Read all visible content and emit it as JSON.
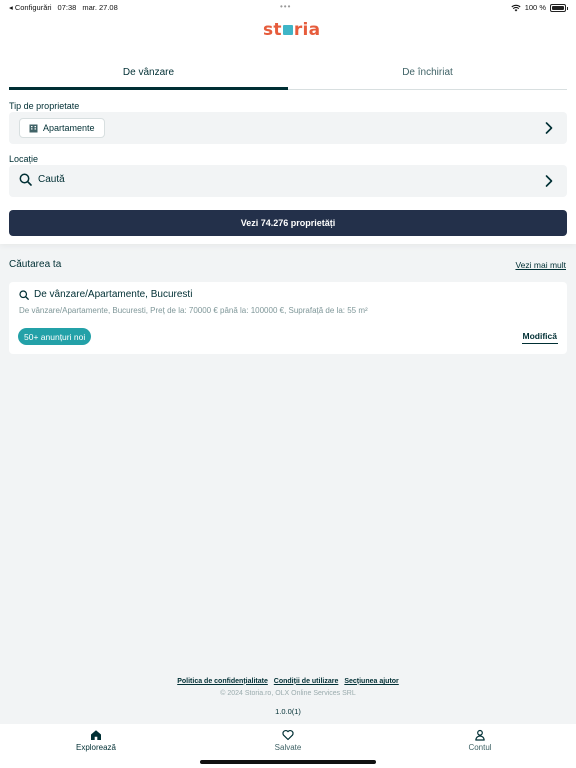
{
  "status_bar": {
    "back_app": "◂ Configurări",
    "time": "07:38",
    "date": "mar. 27.08",
    "dots": "•••",
    "battery": "100 %"
  },
  "brand": {
    "logo_part1": "st",
    "logo_part2": "ria",
    "accent_color": "#e65c3c",
    "square_color": "#3fb5c7"
  },
  "tabs": [
    {
      "label": "De vânzare",
      "active": true
    },
    {
      "label": "De închiriat",
      "active": false
    }
  ],
  "filters": {
    "property_type_label": "Tip de proprietate",
    "property_type_value": "Apartamente",
    "location_label": "Locație",
    "location_placeholder": "Caută"
  },
  "cta": {
    "label": "Vezi 74.276 proprietăți"
  },
  "saved_search": {
    "section_title": "Căutarea ta",
    "see_more": "Vezi mai mult",
    "title": "De vânzare/Apartamente, Bucuresti",
    "description": "De vânzare/Apartamente, Bucuresti, Preț de la: 70000 € până la: 100000 €, Suprafață de la: 55 m²",
    "badge": "50+ anunțuri noi",
    "edit_label": "Modifică"
  },
  "footer": {
    "links": [
      "Politica de confidențialitate",
      "Condiții de utilizare",
      "Secțiunea ajutor"
    ],
    "copyright": "© 2024 Storia.ro, OLX Online Services SRL",
    "version": "1.0.0(1)"
  },
  "bottom_nav": [
    {
      "label": "Explorează",
      "icon": "home-icon",
      "active": true
    },
    {
      "label": "Salvate",
      "icon": "heart-icon",
      "active": false
    },
    {
      "label": "Contul",
      "icon": "user-icon",
      "active": false
    }
  ]
}
